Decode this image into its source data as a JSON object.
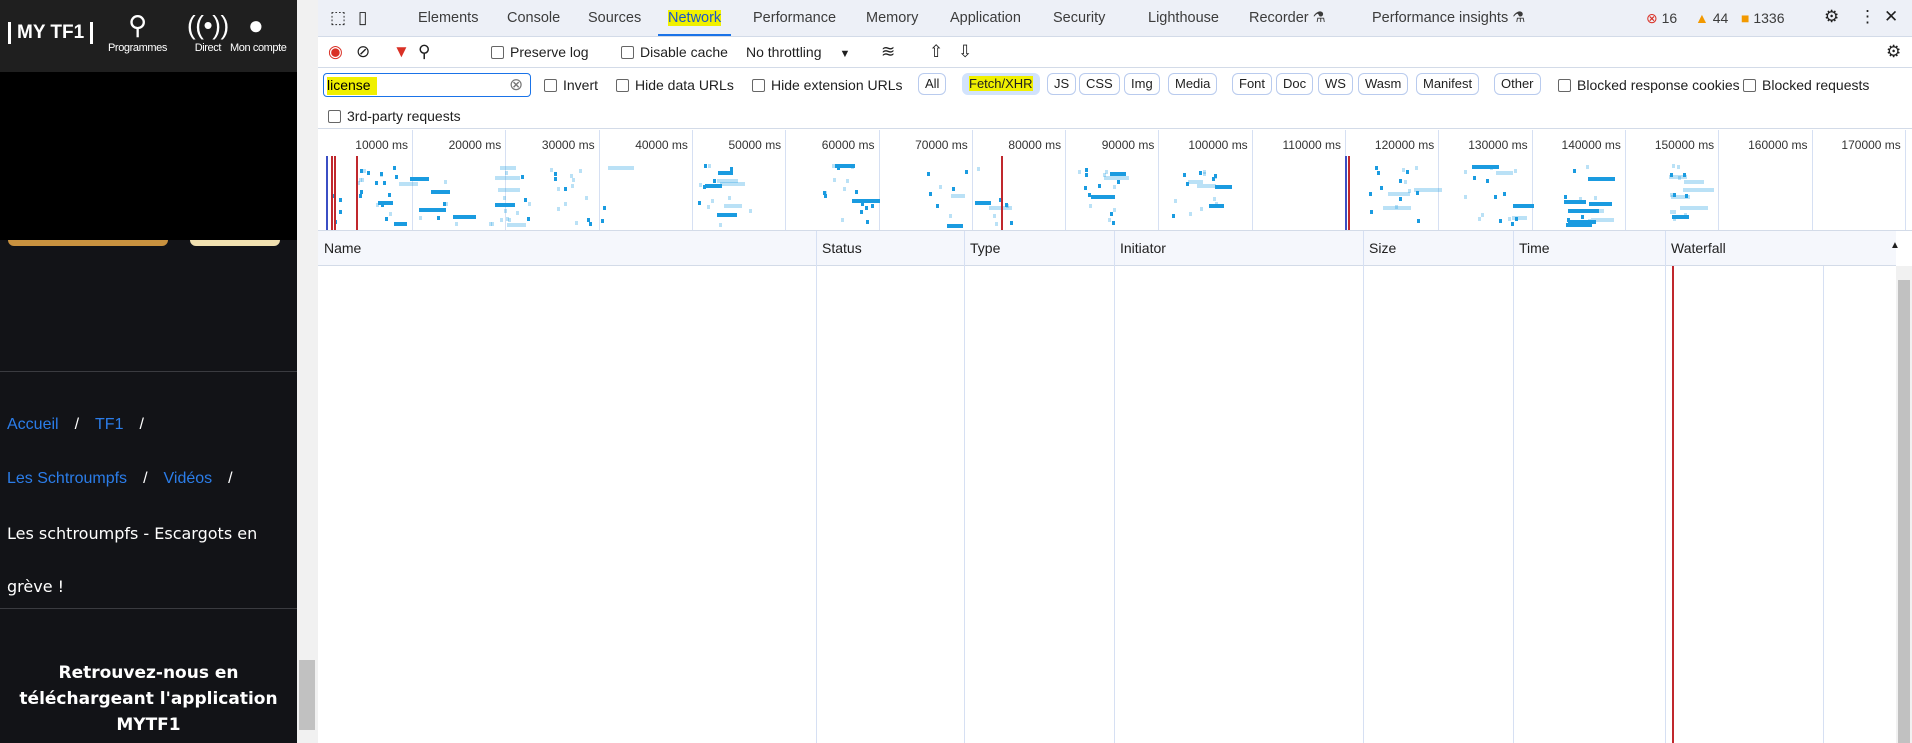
{
  "page": {
    "logo": "MY TF1",
    "nav": [
      {
        "label": "Programmes",
        "icon": "search-icon"
      },
      {
        "label": "Direct",
        "icon": "broadcast-icon"
      },
      {
        "label": "Mon compte",
        "icon": "user-icon"
      }
    ],
    "breadcrumb": [
      "Accueil",
      "TF1",
      "Les Schtroumpfs",
      "Vidéos"
    ],
    "separator": "/",
    "title_line1": "Les schtroumpfs - Escargots en",
    "title_line2": "grève !",
    "promo": [
      "Retrouvez-nous en",
      "téléchargeant l'application",
      "MYTF1"
    ]
  },
  "devtools": {
    "tabs": [
      "Elements",
      "Console",
      "Sources",
      "Network",
      "Performance",
      "Memory",
      "Application",
      "Security",
      "Lighthouse",
      "Recorder",
      "Performance insights"
    ],
    "active_tab": "Network",
    "errors": "16",
    "warnings": "44",
    "issues": "1336",
    "toolbar": {
      "preserve_log": "Preserve log",
      "disable_cache": "Disable cache",
      "throttling": "No throttling"
    },
    "filter": {
      "value": "license",
      "invert": "Invert",
      "hide_data": "Hide data URLs",
      "hide_ext": "Hide extension URLs",
      "types": [
        "All",
        "Fetch/XHR",
        "JS",
        "CSS",
        "Img",
        "Media",
        "Font",
        "Doc",
        "WS",
        "Wasm",
        "Manifest",
        "Other"
      ],
      "selected": "Fetch/XHR",
      "blocked_cookies": "Blocked response cookies",
      "blocked_requests": "Blocked requests",
      "third_party": "3rd-party requests"
    },
    "timeline_ticks": [
      "10000 ms",
      "20000 ms",
      "30000 ms",
      "40000 ms",
      "50000 ms",
      "60000 ms",
      "70000 ms",
      "80000 ms",
      "90000 ms",
      "100000 ms",
      "110000 ms",
      "120000 ms",
      "130000 ms",
      "140000 ms",
      "150000 ms",
      "160000 ms",
      "170000 ms"
    ],
    "columns": [
      "Name",
      "Status",
      "Type",
      "Initiator",
      "Size",
      "Time",
      "Waterfall"
    ],
    "colors": {
      "accent": "#1a73e8",
      "highlight": "#f0f000",
      "error": "#d93025",
      "warning": "#f29900"
    }
  }
}
